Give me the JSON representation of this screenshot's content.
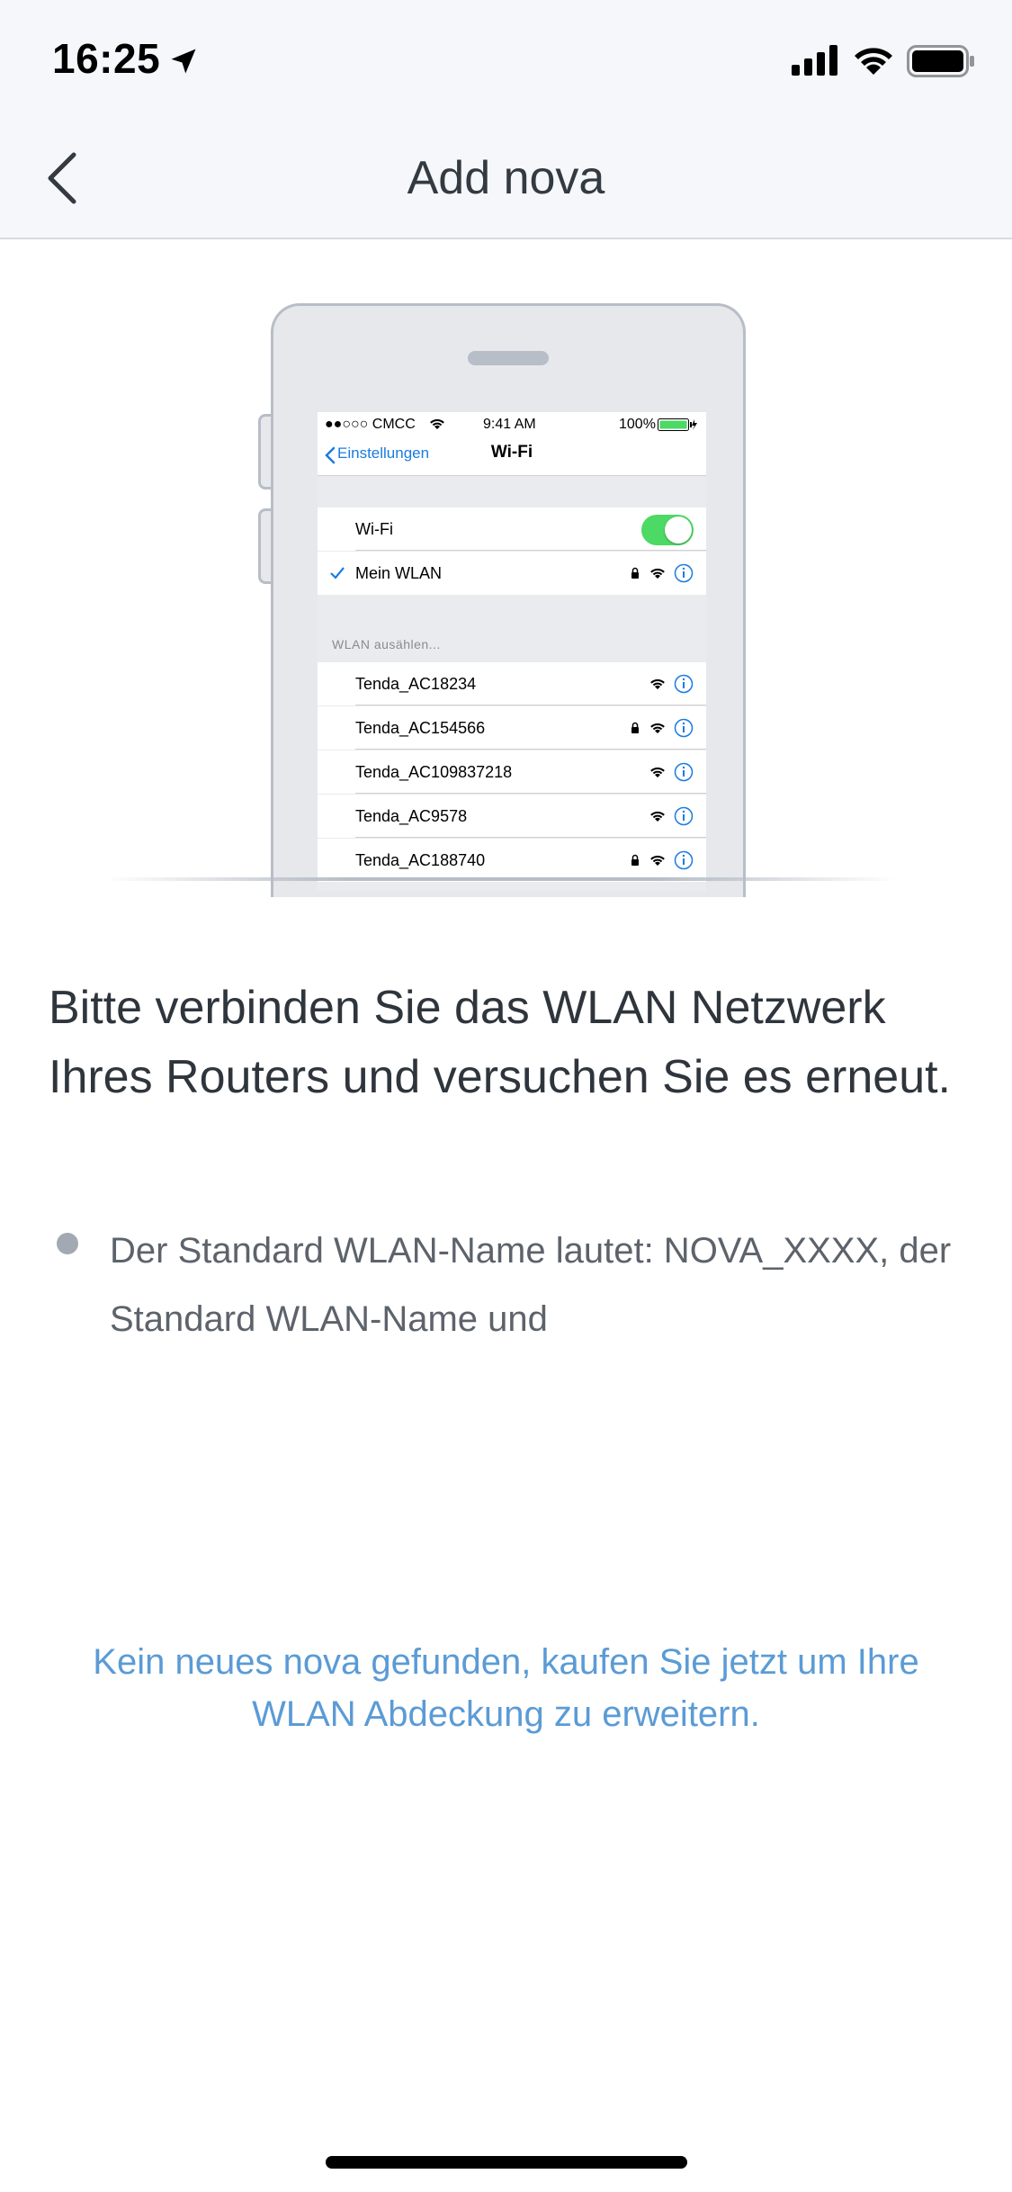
{
  "status_bar": {
    "time": "16:25"
  },
  "nav": {
    "title": "Add nova"
  },
  "illustration": {
    "ios_status": {
      "carrier": "●●○○○ CMCC",
      "time": "9:41 AM",
      "battery": "100%"
    },
    "ios_nav": {
      "back_label": "Einstellungen",
      "title": "Wi-Fi"
    },
    "wifi_row_label": "Wi-Fi",
    "connected_network": "Mein WLAN",
    "section_label": "WLAN ausählen...",
    "networks": [
      {
        "name": "Tenda_AC18234",
        "locked": false
      },
      {
        "name": "Tenda_AC154566",
        "locked": true
      },
      {
        "name": "Tenda_AC109837218",
        "locked": false
      },
      {
        "name": "Tenda_AC9578",
        "locked": false
      },
      {
        "name": "Tenda_AC188740",
        "locked": true
      }
    ]
  },
  "main": {
    "headline": "Bitte verbinden Sie das WLAN Netzwerk Ihres Routers und versuchen Sie es erneut.",
    "bullet": "Der Standard WLAN-Name lautet: NOVA_XXXX, der Standard WLAN-Name und",
    "buy_link": "Kein neues nova gefunden, kaufen Sie jetzt um Ihre WLAN Abdeckung zu erweitern."
  },
  "colors": {
    "link": "#5b9bd5",
    "ios_blue": "#1a7ce0",
    "toggle_green": "#4cd964"
  }
}
